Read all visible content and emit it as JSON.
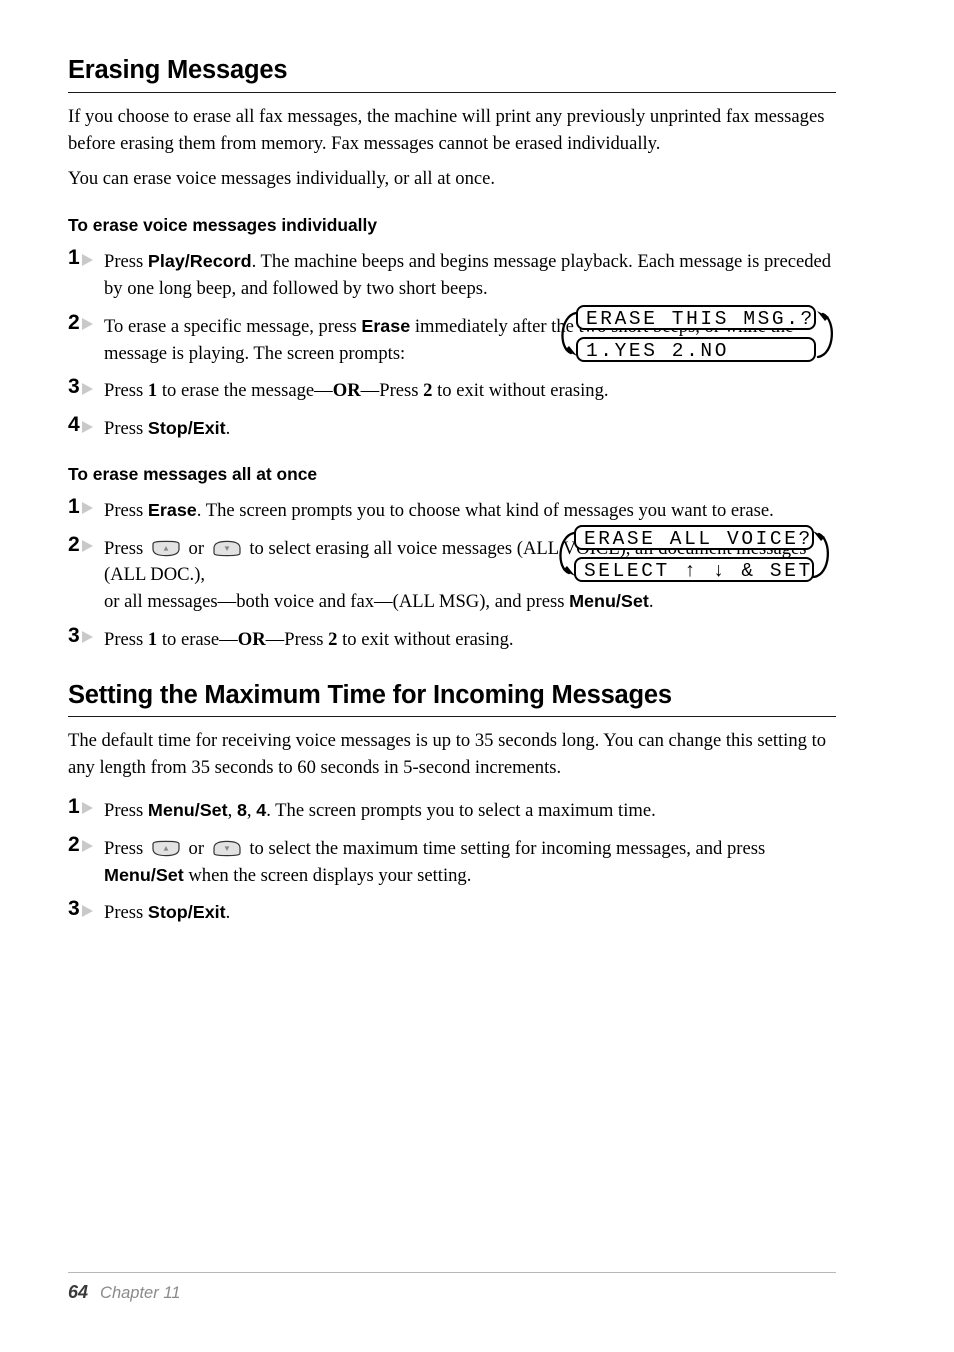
{
  "document": {
    "sections": [
      {
        "title": "Erasing Messages",
        "intro_paragraphs": [
          "If you choose to erase all fax messages, the machine will print any previously unprinted fax messages before erasing them from memory. Fax messages cannot be erased individually.",
          "You can erase voice messages individually, or all at once."
        ]
      },
      {
        "title": "Setting the Maximum Time for Incoming Messages",
        "intro_paragraphs": [
          "The default time for receiving voice messages is up to 35 seconds long. You can change this setting to any length from 35 seconds to 60 seconds in 5-second increments."
        ]
      }
    ],
    "subsections": [
      {
        "title": "To erase voice messages individually"
      },
      {
        "title": "To erase messages all at once"
      }
    ],
    "steps_individually": [
      {
        "number": "1",
        "parts": [
          {
            "t": "Press ",
            "s": "plain"
          },
          {
            "t": "Play/Record",
            "s": "bold"
          },
          {
            "t": ". The machine beeps and begins message playback. Each message is preceded by one long beep, and followed by two short beeps.",
            "s": "plain"
          }
        ]
      },
      {
        "number": "2",
        "parts": [
          {
            "t": "To erase a specific message, press ",
            "s": "plain"
          },
          {
            "t": "Erase",
            "s": "bold"
          },
          {
            "t": " immediately after the two short beeps, or while the message is playing. The screen prompts:",
            "s": "plain"
          }
        ]
      },
      {
        "number": "3",
        "parts": [
          {
            "t": "Press ",
            "s": "plain"
          },
          {
            "t": "1",
            "s": "serifbold"
          },
          {
            "t": " to erase the message—",
            "s": "plain"
          },
          {
            "t": "OR",
            "s": "serifbold"
          },
          {
            "t": "—Press ",
            "s": "plain"
          },
          {
            "t": "2",
            "s": "serifbold"
          },
          {
            "t": " to exit without erasing.",
            "s": "plain"
          }
        ]
      },
      {
        "number": "4",
        "parts": [
          {
            "t": "Press ",
            "s": "plain"
          },
          {
            "t": "Stop/Exit",
            "s": "bold"
          },
          {
            "t": ".",
            "s": "plain"
          }
        ]
      }
    ],
    "steps_all_at_once": [
      {
        "number": "1",
        "parts": [
          {
            "t": "Press ",
            "s": "plain"
          },
          {
            "t": "Erase",
            "s": "bold"
          },
          {
            "t": ". The screen prompts you to choose what kind of messages you want to erase.",
            "s": "plain"
          }
        ]
      },
      {
        "number": "2",
        "parts": [
          {
            "t": "Press ",
            "s": "plain"
          },
          {
            "t": "up-key-icon",
            "s": "icon"
          },
          {
            "t": " or ",
            "s": "plain"
          },
          {
            "t": "down-key-icon",
            "s": "icon"
          },
          {
            "t": " to select erasing all voice messages (ALL VOICE), all document messages (ALL DOC.),",
            "s": "plain"
          },
          {
            "t": "\n",
            "s": "break"
          },
          {
            "t": "or all messages—both voice and fax—(ALL MSG), and press ",
            "s": "plain"
          },
          {
            "t": "Menu/Set",
            "s": "bold"
          },
          {
            "t": ".",
            "s": "plain"
          }
        ]
      },
      {
        "number": "3",
        "parts": [
          {
            "t": "Press ",
            "s": "plain"
          },
          {
            "t": "1",
            "s": "serifbold"
          },
          {
            "t": " to erase—",
            "s": "plain"
          },
          {
            "t": "OR",
            "s": "serifbold"
          },
          {
            "t": "—Press ",
            "s": "plain"
          },
          {
            "t": "2",
            "s": "serifbold"
          },
          {
            "t": " to exit without erasing.",
            "s": "plain"
          }
        ]
      }
    ],
    "steps_max_time": [
      {
        "number": "1",
        "parts": [
          {
            "t": "Press ",
            "s": "plain"
          },
          {
            "t": "Menu/Set",
            "s": "bold"
          },
          {
            "t": ", ",
            "s": "plain"
          },
          {
            "t": "8",
            "s": "bold"
          },
          {
            "t": ", ",
            "s": "plain"
          },
          {
            "t": "4",
            "s": "bold"
          },
          {
            "t": ". The screen prompts you to select a maximum time.",
            "s": "plain"
          }
        ]
      },
      {
        "number": "2",
        "parts": [
          {
            "t": "Press ",
            "s": "plain"
          },
          {
            "t": "up-key-icon",
            "s": "icon"
          },
          {
            "t": " or ",
            "s": "plain"
          },
          {
            "t": "down-key-icon",
            "s": "icon"
          },
          {
            "t": " to select the maximum time setting for incoming messages, and press ",
            "s": "plain"
          },
          {
            "t": "Menu/Set",
            "s": "bold"
          },
          {
            "t": " when the screen displays your setting.",
            "s": "plain"
          }
        ]
      },
      {
        "number": "3",
        "parts": [
          {
            "t": "Press ",
            "s": "plain"
          },
          {
            "t": "Stop/Exit",
            "s": "bold"
          },
          {
            "t": ".",
            "s": "plain"
          }
        ]
      }
    ],
    "lcd_displays": [
      {
        "id": "erase-this-msg",
        "line1": "ERASE THIS MSG.?",
        "line2": "1.YES 2.NO"
      },
      {
        "id": "erase-all-voice",
        "line1": "ERASE ALL VOICE?",
        "line2": "SELECT ↑ ↓ & SET"
      }
    ],
    "footer": {
      "page_number": "64",
      "chapter": "Chapter 11"
    },
    "colors": {
      "text": "#000000",
      "rule": "#1a1a1a",
      "step_triangle": "#c9c9c9",
      "footer_rule": "#b8b8b8",
      "footer_page": "#3a3a3a",
      "footer_chapter": "#8a8a8a",
      "key_icon_fill": "#e2e2e2"
    }
  }
}
